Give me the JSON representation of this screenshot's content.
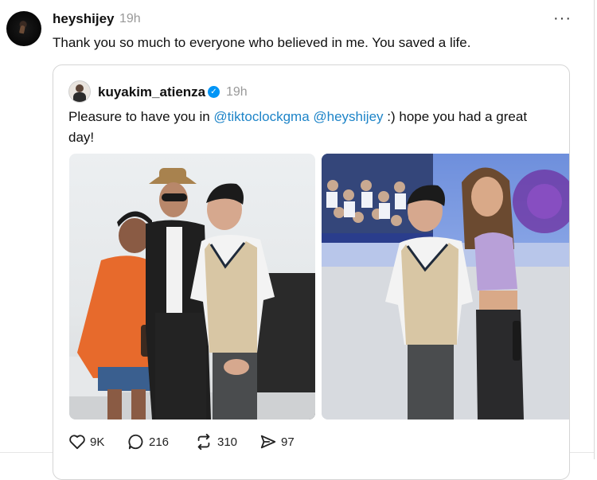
{
  "post": {
    "username": "heyshijey",
    "time": "19h",
    "more_icon": "···",
    "text": "Thank you so much to everyone who believed in me. You saved a life."
  },
  "quote": {
    "username": "kuyakim_atienza",
    "verified_icon": "✓",
    "time": "19h",
    "text_before": "Pleasure to have you in ",
    "mention1": "@tiktoclockgma",
    "text_between": " ",
    "mention2": "@heyshijey",
    "text_after": " :) hope you had a great day!",
    "colors": {
      "mention": "#1d84c8",
      "verified": "#0095f6"
    }
  },
  "actions": {
    "likes": "9K",
    "comments": "216",
    "reposts": "310",
    "shares": "97"
  }
}
